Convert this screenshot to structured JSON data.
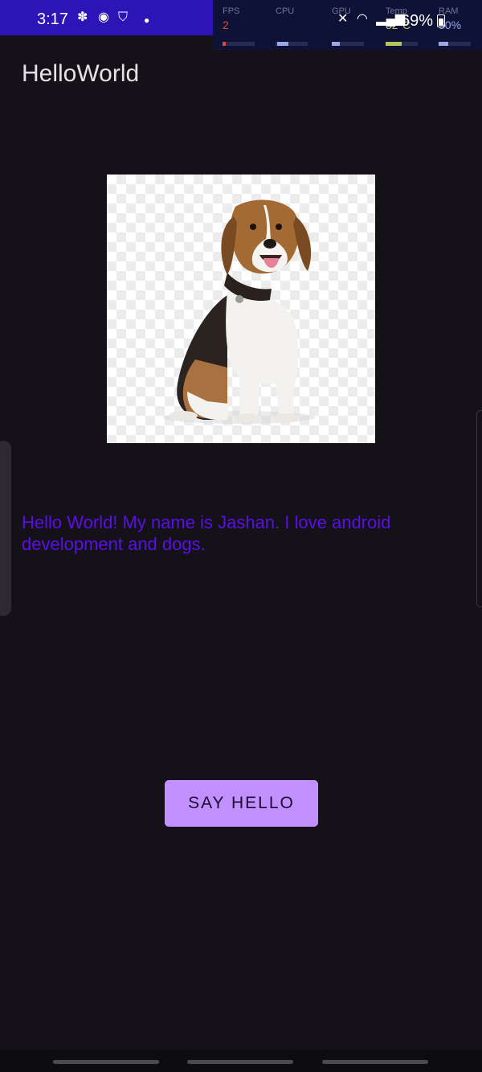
{
  "status_bar": {
    "time": "3:17",
    "left_icons": [
      "fan-icon",
      "chat-icon",
      "shield-icon",
      "dot-icon"
    ],
    "battery_text": "69%",
    "right_icons": [
      "mute-icon",
      "wifi-icon",
      "signal-icon",
      "battery-icon"
    ]
  },
  "perf_overlay": {
    "fps_label": "FPS",
    "fps_value": "2",
    "cpu_label": "CPU",
    "gpu_label": "GPU",
    "temp_label": "Temp",
    "temp_value": "32°C",
    "ram_label": "RAM",
    "ram_value": "50%",
    "colors": {
      "fps": "#e0463d",
      "temp": "#b8c35a",
      "ram": "#9aa8e8"
    }
  },
  "app": {
    "title": "HelloWorld",
    "image_alt": "beagle-dog",
    "message": "Hello World! My name is Jashan. I love android development and dogs.",
    "button_label": "Say Hello"
  },
  "theme": {
    "background": "#141218",
    "accent_text": "#5a0fe8",
    "button_bg": "#c291ff"
  }
}
